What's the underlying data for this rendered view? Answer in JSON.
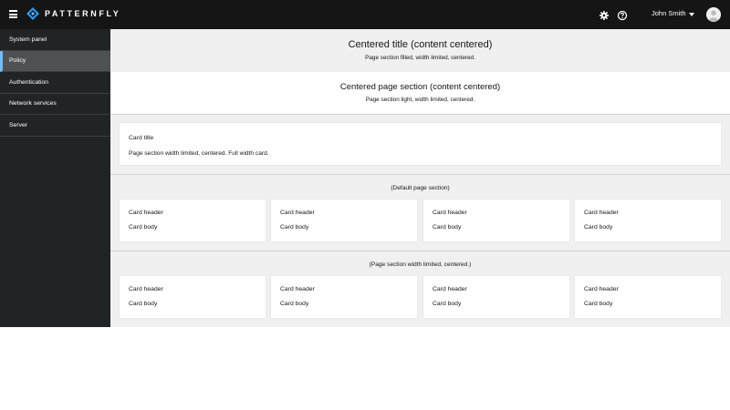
{
  "masthead": {
    "brand": "PATTERNFLY",
    "user": "John Smith",
    "icons": [
      "hamburger-menu-icon",
      "patternfly-logo-icon",
      "gear-icon",
      "help-circle-icon",
      "caret-down-icon",
      "avatar"
    ]
  },
  "sidebar": {
    "items": [
      {
        "label": "System panel",
        "active": false
      },
      {
        "label": "Policy",
        "active": true
      },
      {
        "label": "Authentication",
        "active": false
      },
      {
        "label": "Network services",
        "active": false
      },
      {
        "label": "Server",
        "active": false
      }
    ]
  },
  "main": {
    "filled_section": {
      "title": "Centered title (content centered)",
      "subtitle": "Page section filled, width limited, centered."
    },
    "light_section": {
      "title": "Centered page section (content centered)",
      "subtitle": "Page section light, width limited, centered."
    },
    "full_card": {
      "title": "Card title",
      "body": "Page section width limited, centered. Full width card."
    },
    "default_section": {
      "label": "(Default page section)",
      "cards": [
        {
          "header": "Card header",
          "body": "Card body"
        },
        {
          "header": "Card header",
          "body": "Card body"
        },
        {
          "header": "Card header",
          "body": "Card body"
        },
        {
          "header": "Card header",
          "body": "Card body"
        }
      ]
    },
    "limited_section": {
      "label": "(Page section width limited, centered.)",
      "cards": [
        {
          "header": "Card header",
          "body": "Card body"
        },
        {
          "header": "Card header",
          "body": "Card body"
        },
        {
          "header": "Card header",
          "body": "Card body"
        },
        {
          "header": "Card header",
          "body": "Card body"
        }
      ]
    }
  },
  "colors": {
    "masthead_bg": "#151515",
    "sidebar_bg": "#212427",
    "sidebar_active_bg": "#4f5255",
    "active_indicator": "#73bcf7",
    "section_filled_bg": "#f0f0f0",
    "card_bg": "#ffffff"
  }
}
